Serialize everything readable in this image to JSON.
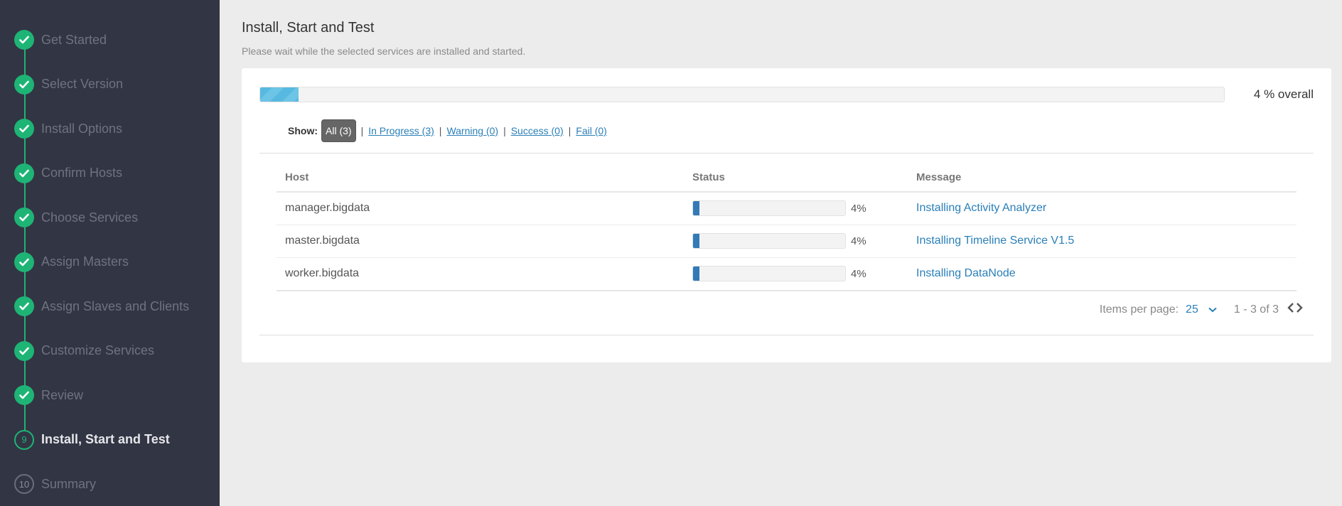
{
  "sidebar": {
    "steps": [
      {
        "number": "1",
        "label": "Get Started",
        "state": "done"
      },
      {
        "number": "2",
        "label": "Select Version",
        "state": "done"
      },
      {
        "number": "3",
        "label": "Install Options",
        "state": "done"
      },
      {
        "number": "4",
        "label": "Confirm Hosts",
        "state": "done"
      },
      {
        "number": "5",
        "label": "Choose Services",
        "state": "done"
      },
      {
        "number": "6",
        "label": "Assign Masters",
        "state": "done"
      },
      {
        "number": "7",
        "label": "Assign Slaves and Clients",
        "state": "done"
      },
      {
        "number": "8",
        "label": "Customize Services",
        "state": "done"
      },
      {
        "number": "9",
        "label": "Review",
        "state": "done"
      },
      {
        "number": "9",
        "label": "Install, Start and Test",
        "state": "current"
      },
      {
        "number": "10",
        "label": "Summary",
        "state": "pending"
      }
    ]
  },
  "main": {
    "title": "Install, Start and Test",
    "subtitle": "Please wait while the selected services are installed and started.",
    "overall": {
      "percent": 4,
      "text": "4 % overall"
    },
    "filters": {
      "show_label": "Show:",
      "all": "All (3)",
      "in_progress": "In Progress (3)",
      "warning": "Warning (0)",
      "success": "Success (0)",
      "fail": "Fail (0)",
      "separator": "|"
    },
    "table": {
      "headers": {
        "host": "Host",
        "status": "Status",
        "message": "Message"
      },
      "rows": [
        {
          "host": "manager.bigdata",
          "percent": 4,
          "percent_text": "4%",
          "message": "Installing Activity Analyzer"
        },
        {
          "host": "master.bigdata",
          "percent": 4,
          "percent_text": "4%",
          "message": "Installing Timeline Service V1.5"
        },
        {
          "host": "worker.bigdata",
          "percent": 4,
          "percent_text": "4%",
          "message": "Installing DataNode"
        }
      ]
    },
    "pagination": {
      "items_per_page_label": "Items per page:",
      "items_per_page": "25",
      "range": "1 - 3 of 3"
    }
  },
  "colors": {
    "accent_green": "#1eb475",
    "link_blue": "#2a7fb8",
    "progress_blue": "#337ab7",
    "sidebar_bg": "#323544"
  }
}
